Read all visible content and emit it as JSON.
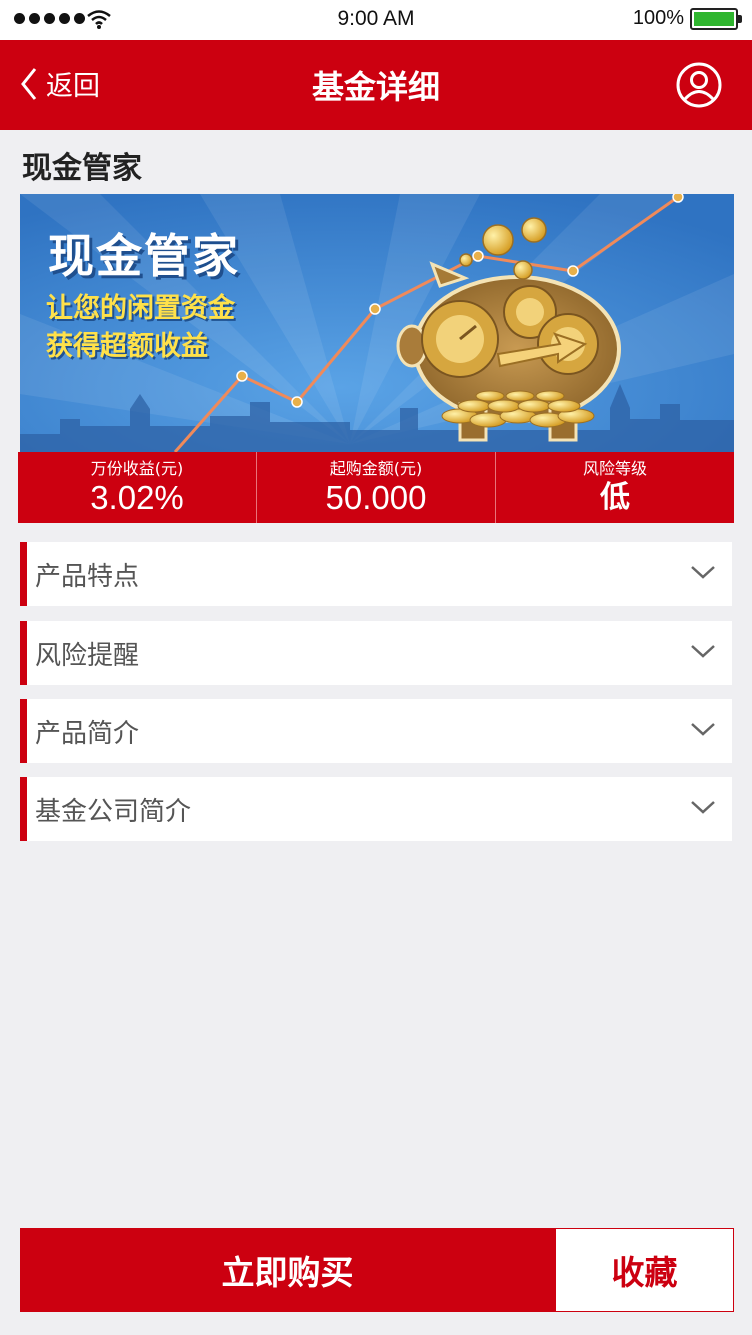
{
  "status_bar": {
    "time": "9:00  AM",
    "battery": "100%"
  },
  "navbar": {
    "back_label": "返回",
    "title": "基金详细"
  },
  "product": {
    "name": "现金管家"
  },
  "banner": {
    "title": "现金管家",
    "line1": "让您的闲置资金",
    "line2": "获得超额收益"
  },
  "stats": [
    {
      "label": "万份收益(元)",
      "value": "3.02%"
    },
    {
      "label": "起购金额(元)",
      "value": "50.000"
    },
    {
      "label": "风险等级",
      "value": "低"
    }
  ],
  "sections": [
    {
      "label": "产品特点"
    },
    {
      "label": "风险提醒"
    },
    {
      "label": "产品简介"
    },
    {
      "label": "基金公司简介"
    }
  ],
  "actions": {
    "buy_label": "立即购买",
    "favorite_label": "收藏"
  },
  "colors": {
    "brand_red": "#cc0010",
    "background": "#efeff2",
    "banner_blue": "#3d8ad6",
    "gold": "#e0b23c"
  },
  "icons": [
    "signal-icon",
    "wifi-icon",
    "battery-icon",
    "back-chevron-icon",
    "user-icon",
    "chevron-down-icon",
    "piggy-bank-icon",
    "coin-icon",
    "gear-icon"
  ]
}
